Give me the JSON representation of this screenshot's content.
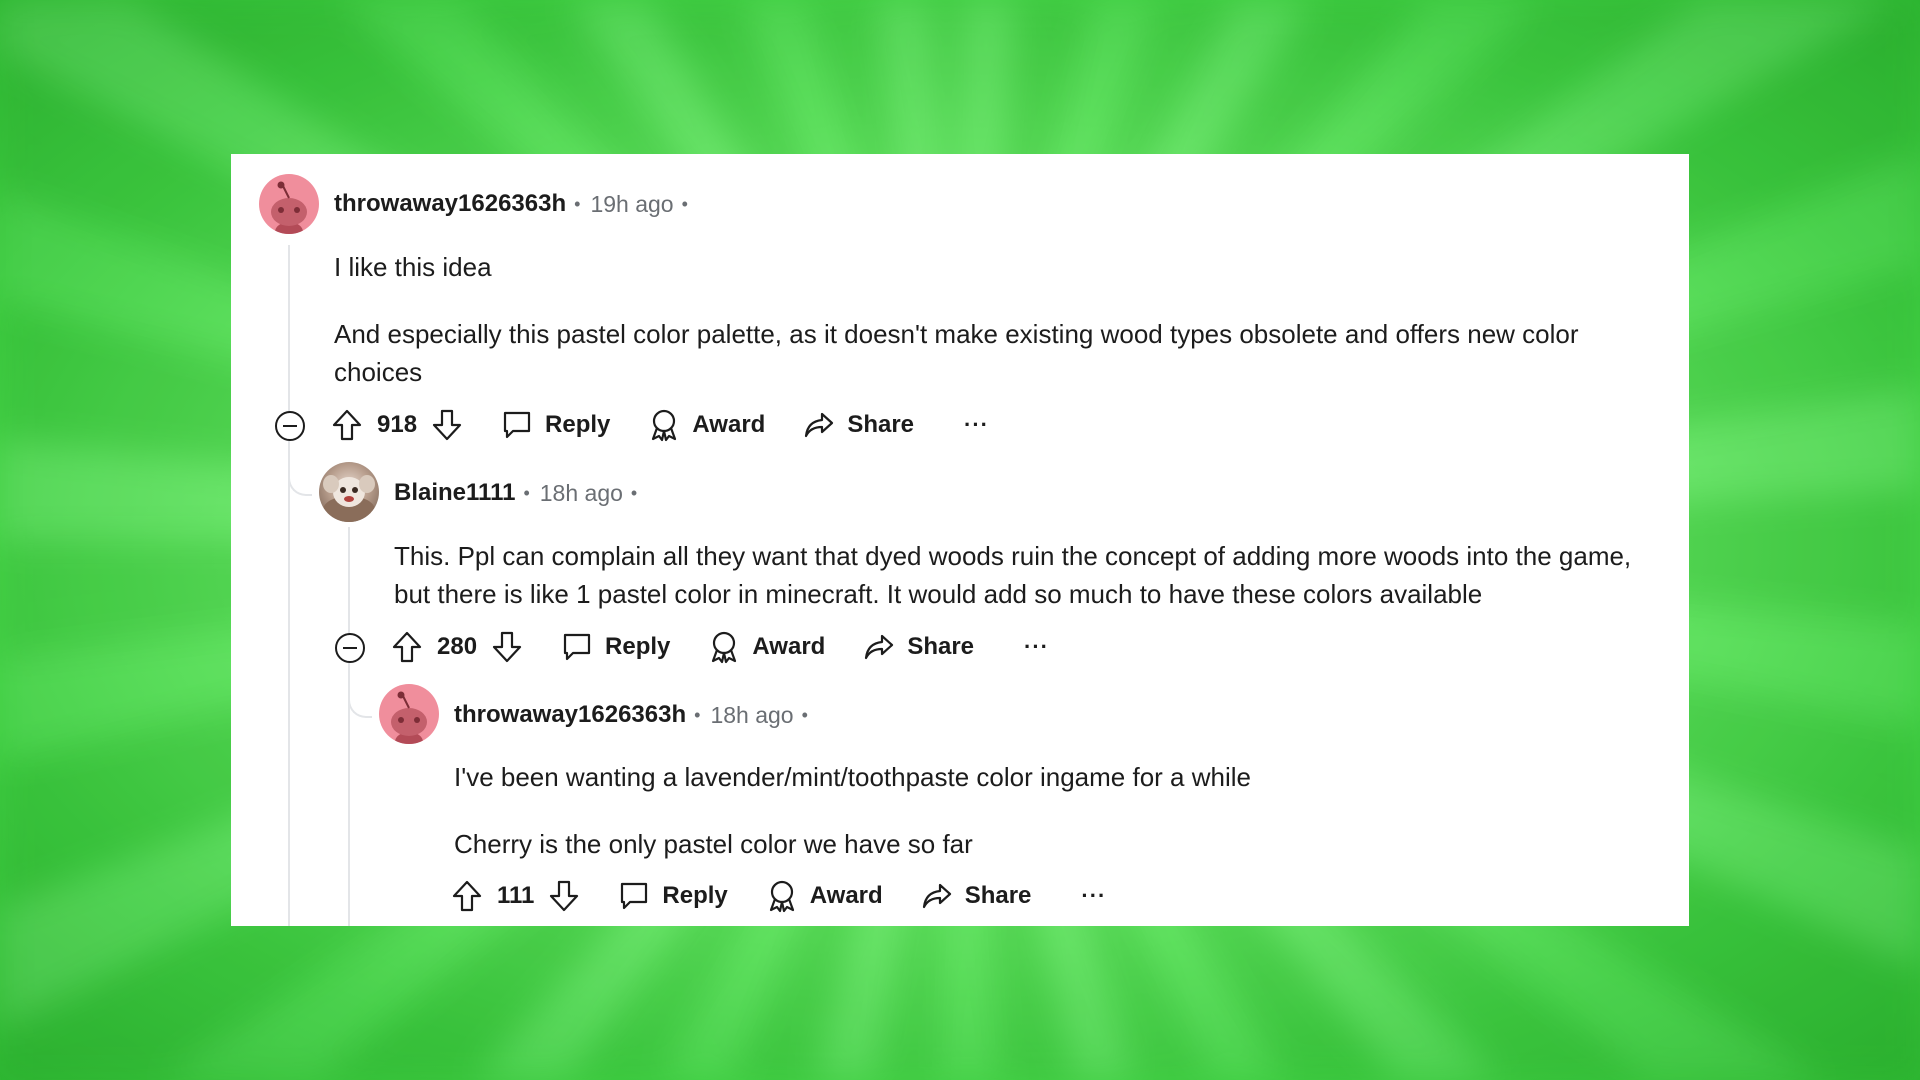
{
  "comments": [
    {
      "username": "throwaway1626363h",
      "time": "19h ago",
      "paragraphs": [
        "I like this idea",
        "And especially this pastel color palette, as it doesn't make existing wood types obsolete and offers new color choices"
      ],
      "score": "918"
    },
    {
      "username": "Blaine1111",
      "time": "18h ago",
      "paragraphs": [
        "This. Ppl can complain all they want that dyed woods ruin the concept of adding more woods into the game, but there is like 1 pastel color in minecraft. It would add so much to have these colors available"
      ],
      "score": "280"
    },
    {
      "username": "throwaway1626363h",
      "time": "18h ago",
      "paragraphs": [
        "I've been wanting a lavender/mint/toothpaste color ingame for a while",
        "Cherry is the only pastel color we have so far"
      ],
      "score": "111"
    }
  ],
  "actions": {
    "reply": "Reply",
    "award": "Award",
    "share": "Share",
    "more": "···"
  },
  "meta_separator": "•",
  "colors": {
    "background_green": "#6ef06b",
    "card": "#ffffff",
    "avatar_pink": "#f08e9c",
    "text": "#1c1c1c",
    "muted": "#6a6e73",
    "thread_line": "#e3e5e8"
  }
}
